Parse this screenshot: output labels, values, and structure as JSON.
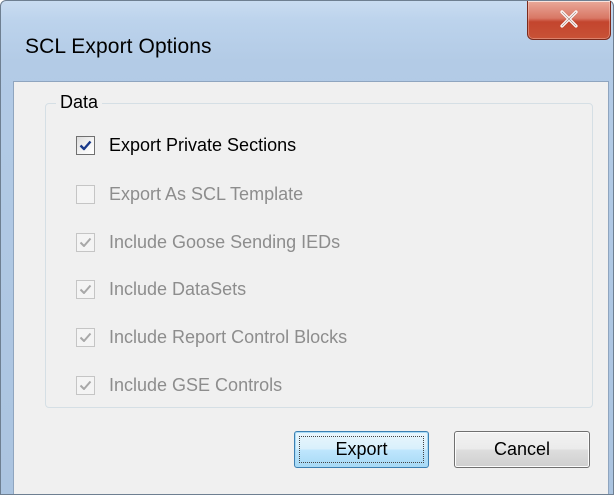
{
  "window": {
    "title": "SCL Export Options",
    "close_icon": "close-x-icon"
  },
  "group": {
    "legend": "Data"
  },
  "options": [
    {
      "label": "Export Private Sections",
      "checked": true,
      "enabled": true
    },
    {
      "label": "Export As SCL Template",
      "checked": false,
      "enabled": false
    },
    {
      "label": "Include Goose Sending IEDs",
      "checked": true,
      "enabled": false
    },
    {
      "label": "Include DataSets",
      "checked": true,
      "enabled": false
    },
    {
      "label": "Include Report Control Blocks",
      "checked": true,
      "enabled": false
    },
    {
      "label": "Include GSE Controls",
      "checked": true,
      "enabled": false
    }
  ],
  "buttons": {
    "export_label": "Export",
    "cancel_label": "Cancel"
  },
  "colors": {
    "check_enabled": "#1a3a8a",
    "check_disabled": "#a8a8a8",
    "close_button": "#c85236"
  }
}
